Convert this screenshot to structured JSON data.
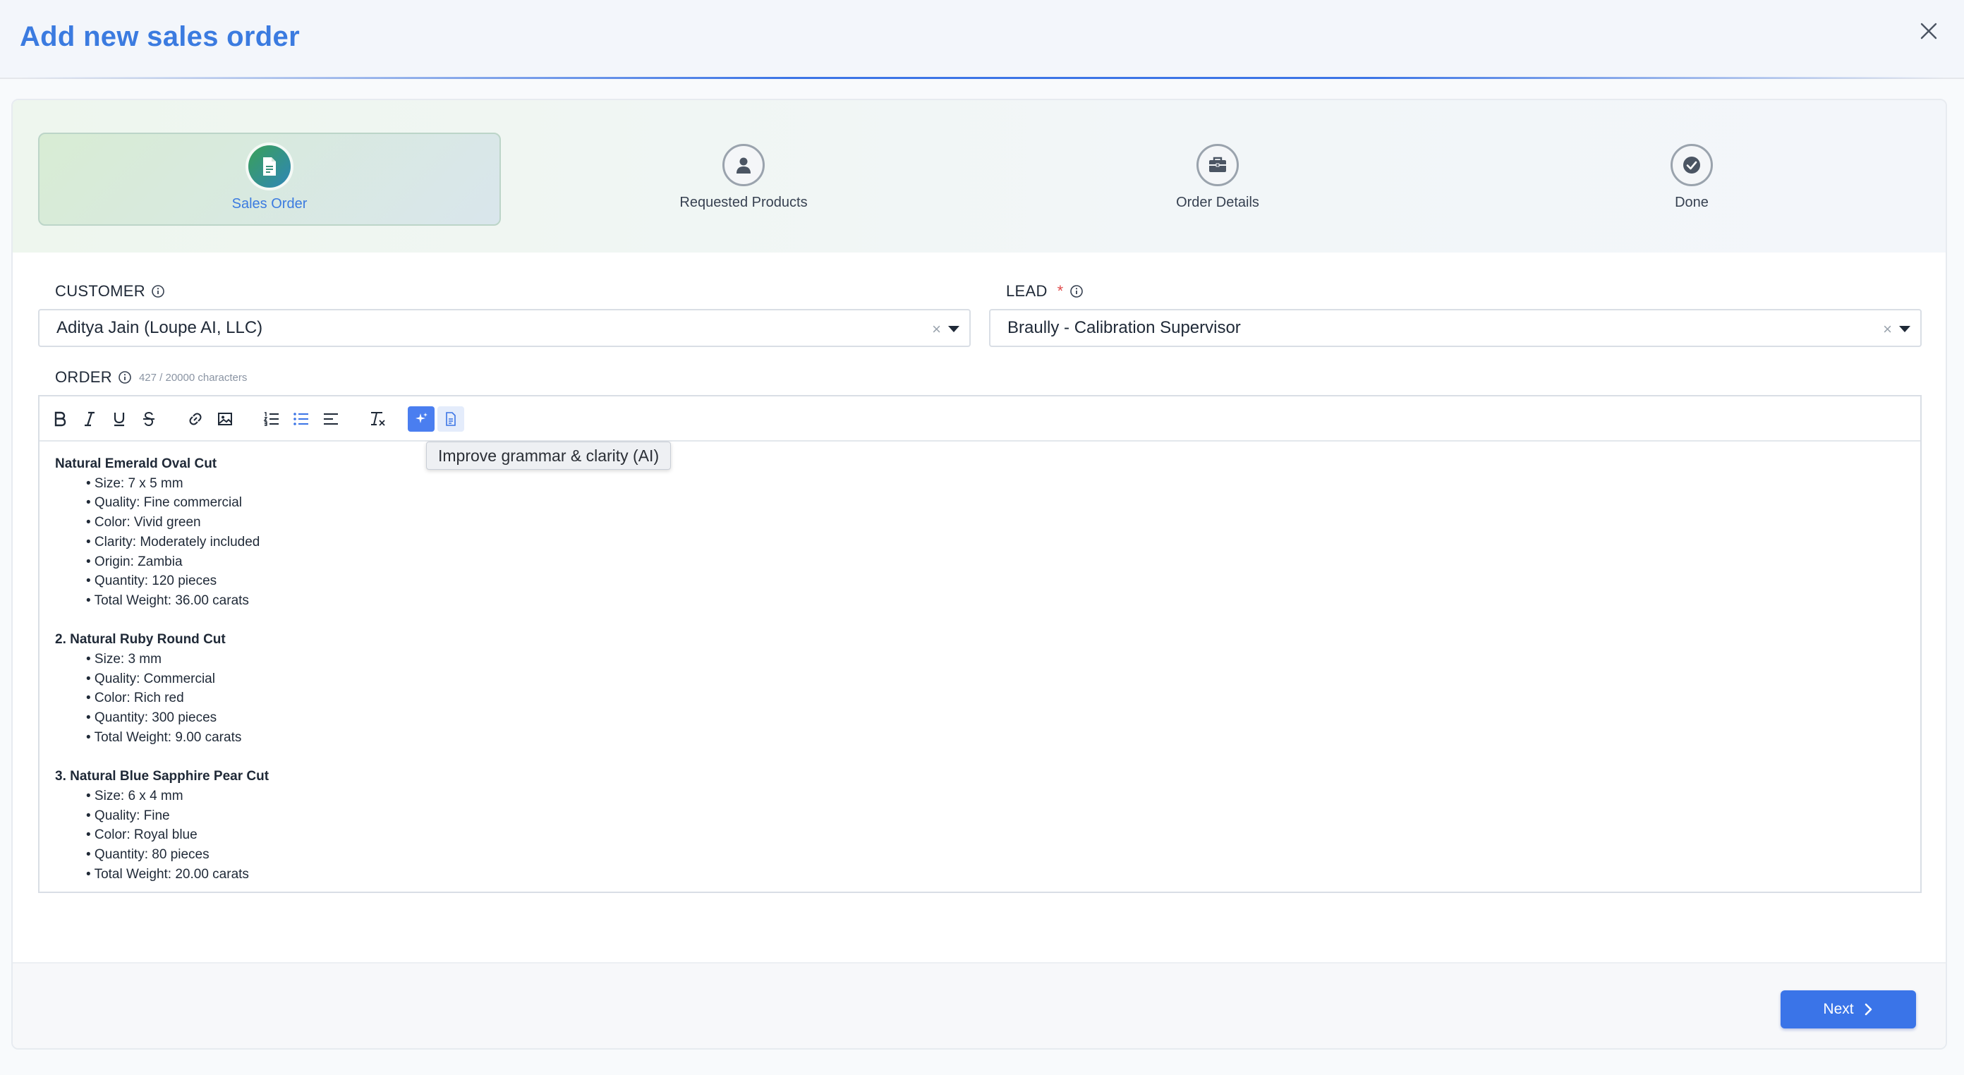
{
  "modal": {
    "title": "Add new sales order",
    "close_icon": "close-icon"
  },
  "steps": [
    {
      "label": "Sales Order",
      "icon": "document-icon",
      "active": true
    },
    {
      "label": "Requested Products",
      "icon": "user-icon",
      "active": false
    },
    {
      "label": "Order Details",
      "icon": "briefcase-icon",
      "active": false
    },
    {
      "label": "Done",
      "icon": "check-circle-icon",
      "active": false
    }
  ],
  "customer": {
    "label": "CUSTOMER",
    "value": "Aditya Jain (Loupe AI, LLC)",
    "clear": "×"
  },
  "lead": {
    "label": "LEAD",
    "required_mark": "*",
    "value": "Braully - Calibration Supervisor",
    "clear": "×"
  },
  "order": {
    "label": "ORDER",
    "char_count": "427 / 20000 characters",
    "tooltip": "Improve grammar & clarity (AI)",
    "toolbar": [
      "bold-icon",
      "italic-icon",
      "underline-icon",
      "strikethrough-icon",
      "link-icon",
      "image-icon",
      "ordered-list-icon",
      "bullet-list-icon",
      "align-icon",
      "clear-format-icon",
      "ai-sparkle-icon",
      "document-icon"
    ],
    "items": [
      {
        "title": "Natural Emerald Oval Cut",
        "bullets": [
          "• Size: 7 x 5 mm",
          "• Quality: Fine commercial",
          "• Color: Vivid green",
          "• Clarity: Moderately included",
          "• Origin: Zambia",
          "• Quantity: 120 pieces",
          "• Total Weight: 36.00 carats"
        ]
      },
      {
        "title": "2. Natural Ruby Round Cut",
        "bullets": [
          "• Size: 3 mm",
          "• Quality: Commercial",
          "• Color: Rich red",
          "• Quantity: 300 pieces",
          "• Total Weight: 9.00 carats"
        ]
      },
      {
        "title": "3. Natural Blue Sapphire Pear Cut",
        "bullets": [
          "• Size: 6 x 4 mm",
          "• Quality: Fine",
          "• Color: Royal blue",
          "• Quantity: 80 pieces",
          "• Total Weight: 20.00 carats"
        ]
      }
    ]
  },
  "footer": {
    "next_label": "Next"
  },
  "colors": {
    "accent": "#3b7be0",
    "primary_button": "#3a74e8",
    "ai_button": "#4a7ef0",
    "required": "#e04b4b"
  }
}
